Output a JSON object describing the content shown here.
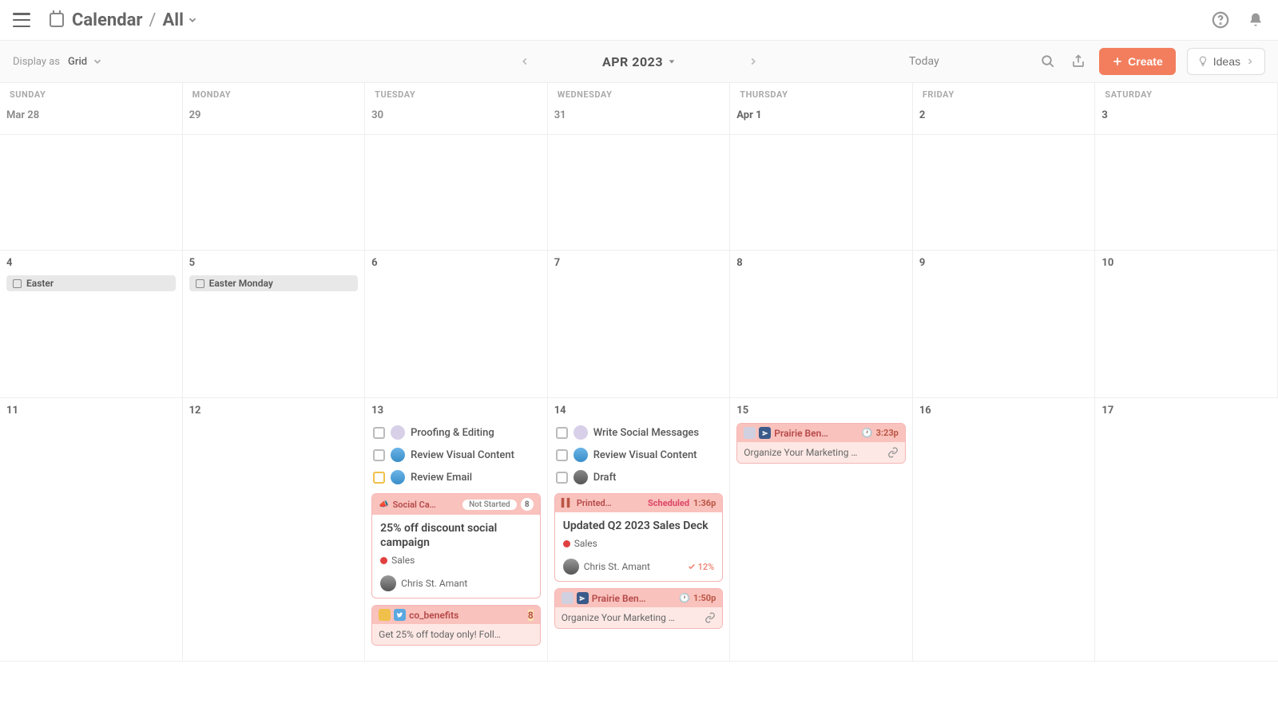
{
  "header": {
    "app": "Calendar",
    "crumb_last": "All"
  },
  "toolbar": {
    "display_as": "Display as",
    "display_value": "Grid",
    "month": "APR 2023",
    "today": "Today",
    "create": "Create",
    "ideas": "Ideas"
  },
  "weekdays": [
    "SUNDAY",
    "MONDAY",
    "TUESDAY",
    "WEDNESDAY",
    "THURSDAY",
    "FRIDAY",
    "SATURDAY"
  ],
  "weeks": [
    [
      "Mar 28",
      "29",
      "30",
      "31",
      "Apr 1",
      "2",
      "3"
    ],
    [
      "4",
      "5",
      "6",
      "7",
      "8",
      "9",
      "10"
    ],
    [
      "11",
      "12",
      "13",
      "14",
      "15",
      "16",
      "17"
    ]
  ],
  "holidays": {
    "sun4": "Easter",
    "mon5": "Easter Monday"
  },
  "tasks": {
    "d13": [
      {
        "label": "Proofing & Editing",
        "avatar": "lav",
        "check": "grey"
      },
      {
        "label": "Review Visual Content",
        "avatar": "blue",
        "check": "grey"
      },
      {
        "label": "Review Email",
        "avatar": "blue",
        "check": "yellow"
      }
    ],
    "d14": [
      {
        "label": "Write Social Messages",
        "avatar": "lav",
        "check": "grey"
      },
      {
        "label": "Review Visual Content",
        "avatar": "blue",
        "check": "grey"
      },
      {
        "label": "Draft",
        "avatar": "grey",
        "check": "grey"
      }
    ]
  },
  "cards": {
    "d13_main": {
      "head_label": "Social Ca…",
      "status": "Not Started",
      "count": "8",
      "title": "25% off discount social campaign",
      "tag": "Sales",
      "owner": "Chris St. Amant"
    },
    "d13_small": {
      "head": "co_benefits",
      "count": "8",
      "body": "Get 25% off today only! Foll…"
    },
    "d14_main": {
      "head_label": "Printed…",
      "status": "Scheduled",
      "time": "1:36p",
      "title": "Updated Q2 2023 Sales Deck",
      "tag": "Sales",
      "owner": "Chris St. Amant",
      "progress": "12%"
    },
    "d14_small": {
      "head": "Prairie Ben…",
      "time": "1:50p",
      "body": "Organize Your Marketing …"
    },
    "d15_small": {
      "head": "Prairie Ben…",
      "time": "3:23p",
      "body": "Organize Your Marketing …"
    }
  }
}
